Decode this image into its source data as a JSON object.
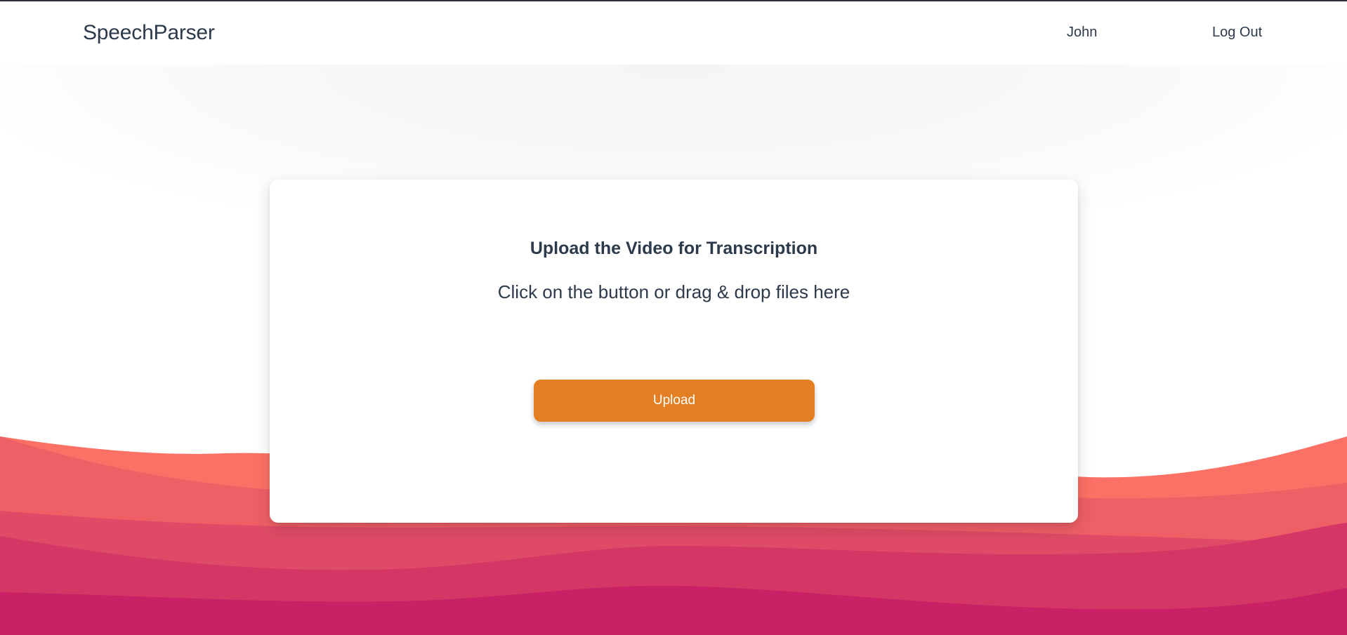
{
  "navbar": {
    "brand": "SpeechParser",
    "user_label": "John",
    "logout_label": "Log Out"
  },
  "upload": {
    "title": "Upload the Video for Transcription",
    "subtitle": "Click on the button or drag & drop files here",
    "button_label": "Upload"
  },
  "colors": {
    "text": "#2c3a4b",
    "accent": "#e47e22",
    "wave_1": "#fc7165",
    "wave_2": "#ee5f66",
    "wave_3": "#df4b66",
    "wave_4": "#d43766",
    "wave_5": "#c82165"
  }
}
